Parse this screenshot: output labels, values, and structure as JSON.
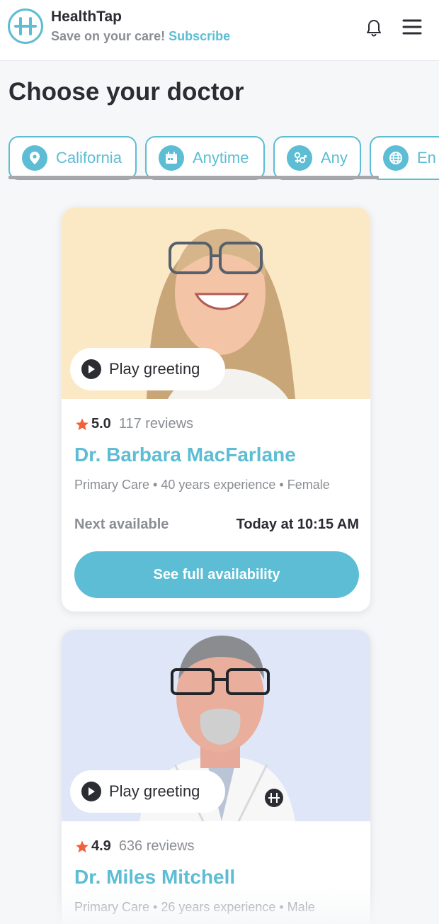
{
  "header": {
    "brand": "HealthTap",
    "tagline": "Save on your care!",
    "subscribe_label": "Subscribe",
    "logo_icon": "healthtap-logo-icon",
    "bell_icon": "bell-icon",
    "menu_icon": "hamburger-menu-icon"
  },
  "page": {
    "title": "Choose your doctor"
  },
  "filters": [
    {
      "label": "California",
      "icon": "location-pin-icon"
    },
    {
      "label": "Anytime",
      "icon": "calendar-icon"
    },
    {
      "label": "Any",
      "icon": "gender-icon"
    },
    {
      "label": "En",
      "icon": "globe-icon"
    }
  ],
  "doctors": [
    {
      "play_label": "Play greeting",
      "rating": "5.0",
      "reviews": "117 reviews",
      "name": "Dr. Barbara MacFarlane",
      "meta": "Primary Care • 40 years experience • Female",
      "next_label": "Next available",
      "next_value": "Today at 10:15 AM",
      "button_label": "See full availability"
    },
    {
      "play_label": "Play greeting",
      "rating": "4.9",
      "reviews": "636 reviews",
      "name": "Dr. Miles Mitchell",
      "meta": "Primary Care • 26 years experience • Male"
    }
  ],
  "colors": {
    "accent": "#5cbdd4",
    "star": "#f0623a",
    "text_dark": "#2b2d33",
    "text_muted": "#8a8d93",
    "photo_bg_1": "#fbe9c6",
    "photo_bg_2": "#dfe6f7"
  }
}
